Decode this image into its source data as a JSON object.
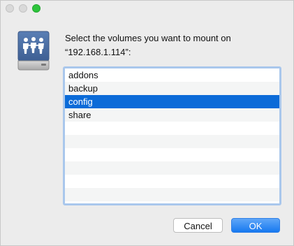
{
  "dialog": {
    "prompt_line1": "Select the volumes you want to mount on",
    "prompt_line2": "“192.168.1.114”:"
  },
  "volumes": {
    "items": [
      "addons",
      "backup",
      "config",
      "share"
    ],
    "selected": "config"
  },
  "buttons": {
    "cancel_label": "Cancel",
    "ok_label": "OK"
  },
  "icons": {
    "drive": "network-share-drive-icon"
  },
  "colors": {
    "selection": "#0b6bd8",
    "default_button": "#1779f0",
    "focus_ring": "#a9c7ec"
  }
}
